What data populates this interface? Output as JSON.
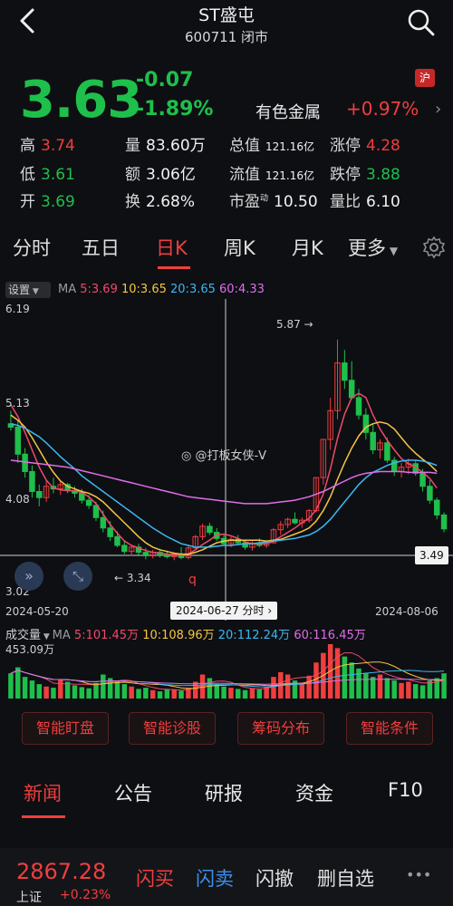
{
  "header": {
    "title": "ST盛屯",
    "subtitle": "600711 闭市"
  },
  "quote": {
    "price": "3.63",
    "change": "-0.07",
    "change_pct": "-1.89%",
    "market_tag": "沪",
    "sector_name": "有色金属",
    "sector_change": "+0.97%",
    "stats": [
      {
        "label": "高",
        "value": "3.74",
        "color": "red"
      },
      {
        "label": "量",
        "value": "83.60万",
        "color": "white"
      },
      {
        "label": "总值",
        "value": "121.16亿",
        "color": "white",
        "small": true
      },
      {
        "label": "涨停",
        "value": "4.28",
        "color": "red"
      },
      {
        "label": "低",
        "value": "3.61",
        "color": "green"
      },
      {
        "label": "额",
        "value": "3.06亿",
        "color": "white"
      },
      {
        "label": "流值",
        "value": "121.16亿",
        "color": "white",
        "small": true
      },
      {
        "label": "跌停",
        "value": "3.88",
        "color": "green"
      },
      {
        "label": "开",
        "value": "3.69",
        "color": "green"
      },
      {
        "label": "换",
        "value": "2.68%",
        "color": "white"
      },
      {
        "label": "市盈",
        "sup": "动",
        "value": "10.50",
        "color": "white"
      },
      {
        "label": "量比",
        "value": "6.10",
        "color": "white"
      }
    ]
  },
  "chart_tabs": [
    "分时",
    "五日",
    "日K",
    "周K",
    "月K",
    "更多"
  ],
  "active_chart_tab": "日K",
  "ma_legend": {
    "settings": "设置",
    "prefix": "MA",
    "items": [
      {
        "text": "5:3.69",
        "color": "#f04a6a"
      },
      {
        "text": "10:3.65",
        "color": "#f5c542"
      },
      {
        "text": "20:3.65",
        "color": "#3db8f0"
      },
      {
        "text": "60:4.33",
        "color": "#e06ee8"
      }
    ]
  },
  "chart_labels": {
    "y_top": "6.19",
    "y_upper": "5.13",
    "y_mid": "4.08",
    "y_bottom": "3.02",
    "high_mark": "5.87",
    "low_mark": "3.34",
    "cursor_price": "3.49",
    "cursor_date": "2024-06-27 分时",
    "date_start": "2024-05-20",
    "date_end": "2024-08-06",
    "watermark": "@打板女侠-V",
    "q_mark": "q"
  },
  "volume": {
    "title": "成交量",
    "prefix": "MA",
    "items": [
      {
        "text": "5:101.45万",
        "color": "#f04a6a"
      },
      {
        "text": "10:108.96万",
        "color": "#f5c542"
      },
      {
        "text": "20:112.24万",
        "color": "#3db8f0"
      },
      {
        "text": "60:116.45万",
        "color": "#e06ee8"
      }
    ],
    "max_label": "453.09万"
  },
  "tool_buttons": [
    "智能盯盘",
    "智能诊股",
    "筹码分布",
    "智能条件"
  ],
  "bottom_tabs": [
    "新闻",
    "公告",
    "研报",
    "资金",
    "F10"
  ],
  "active_bottom_tab": "新闻",
  "footer": {
    "index_value": "2867.28",
    "index_name": "上证",
    "index_change": "+0.23%",
    "buy": "闪买",
    "sell": "闪卖",
    "cancel": "闪撤",
    "remove": "删自选",
    "more": "•••"
  },
  "chart_data": {
    "type": "candlestick",
    "ylim": [
      3.02,
      6.19
    ],
    "candles": [
      [
        4.9,
        5.05,
        4.82,
        4.86
      ],
      [
        4.86,
        4.95,
        4.45,
        4.55
      ],
      [
        4.55,
        4.62,
        4.28,
        4.35
      ],
      [
        4.35,
        4.42,
        4.05,
        4.12
      ],
      [
        4.12,
        4.2,
        3.95,
        4.05
      ],
      [
        4.05,
        4.25,
        4.0,
        4.18
      ],
      [
        4.18,
        4.28,
        4.1,
        4.15
      ],
      [
        4.15,
        4.24,
        4.08,
        4.2
      ],
      [
        4.2,
        4.22,
        4.1,
        4.13
      ],
      [
        4.13,
        4.18,
        4.05,
        4.1
      ],
      [
        4.1,
        4.15,
        3.98,
        4.02
      ],
      [
        4.02,
        4.08,
        3.92,
        3.96
      ],
      [
        3.96,
        4.0,
        3.78,
        3.82
      ],
      [
        3.82,
        3.9,
        3.65,
        3.7
      ],
      [
        3.7,
        3.78,
        3.55,
        3.6
      ],
      [
        3.6,
        3.66,
        3.48,
        3.5
      ],
      [
        3.5,
        3.56,
        3.4,
        3.43
      ],
      [
        3.43,
        3.5,
        3.38,
        3.48
      ],
      [
        3.48,
        3.52,
        3.39,
        3.42
      ],
      [
        3.42,
        3.47,
        3.34,
        3.38
      ],
      [
        3.38,
        3.45,
        3.35,
        3.42
      ],
      [
        3.42,
        3.46,
        3.36,
        3.39
      ],
      [
        3.39,
        3.44,
        3.35,
        3.37
      ],
      [
        3.37,
        3.42,
        3.33,
        3.4
      ],
      [
        3.4,
        3.48,
        3.34,
        3.36
      ],
      [
        3.36,
        3.5,
        3.34,
        3.47
      ],
      [
        3.47,
        3.62,
        3.45,
        3.6
      ],
      [
        3.6,
        3.75,
        3.56,
        3.72
      ],
      [
        3.72,
        3.76,
        3.62,
        3.65
      ],
      [
        3.65,
        3.7,
        3.55,
        3.58
      ],
      [
        3.58,
        3.62,
        3.5,
        3.52
      ],
      [
        3.52,
        3.6,
        3.48,
        3.57
      ],
      [
        3.57,
        3.62,
        3.5,
        3.53
      ],
      [
        3.53,
        3.56,
        3.45,
        3.48
      ],
      [
        3.48,
        3.55,
        3.44,
        3.52
      ],
      [
        3.52,
        3.58,
        3.48,
        3.5
      ],
      [
        3.5,
        3.56,
        3.47,
        3.53
      ],
      [
        3.53,
        3.7,
        3.52,
        3.68
      ],
      [
        3.68,
        3.78,
        3.62,
        3.74
      ],
      [
        3.74,
        3.82,
        3.7,
        3.8
      ],
      [
        3.8,
        3.88,
        3.74,
        3.76
      ],
      [
        3.76,
        3.82,
        3.7,
        3.79
      ],
      [
        3.79,
        3.92,
        3.76,
        3.9
      ],
      [
        3.9,
        4.28,
        3.88,
        4.28
      ],
      [
        4.28,
        4.72,
        4.2,
        4.72
      ],
      [
        4.72,
        5.2,
        4.6,
        5.05
      ],
      [
        5.05,
        5.87,
        4.95,
        5.6
      ],
      [
        5.6,
        5.75,
        5.3,
        5.4
      ],
      [
        5.4,
        5.62,
        5.18,
        5.2
      ],
      [
        5.2,
        5.3,
        4.95,
        5.0
      ],
      [
        5.0,
        5.08,
        4.72,
        4.8
      ],
      [
        4.8,
        4.9,
        4.55,
        4.6
      ],
      [
        4.6,
        4.72,
        4.5,
        4.68
      ],
      [
        4.68,
        4.74,
        4.45,
        4.48
      ],
      [
        4.48,
        4.52,
        4.3,
        4.35
      ],
      [
        4.35,
        4.45,
        4.28,
        4.4
      ],
      [
        4.4,
        4.5,
        4.32,
        4.44
      ],
      [
        4.44,
        4.48,
        4.3,
        4.33
      ],
      [
        4.33,
        4.38,
        4.12,
        4.18
      ],
      [
        4.18,
        4.25,
        3.98,
        4.02
      ],
      [
        4.02,
        4.05,
        3.8,
        3.85
      ],
      [
        3.85,
        3.88,
        3.65,
        3.69
      ]
    ],
    "ma5": [
      5.12,
      4.98,
      4.8,
      4.6,
      4.4,
      4.25,
      4.16,
      4.14,
      4.13,
      4.13,
      4.11,
      4.06,
      3.98,
      3.86,
      3.74,
      3.64,
      3.55,
      3.5,
      3.47,
      3.44,
      3.42,
      3.41,
      3.4,
      3.39,
      3.39,
      3.4,
      3.45,
      3.51,
      3.56,
      3.62,
      3.63,
      3.61,
      3.58,
      3.54,
      3.52,
      3.52,
      3.52,
      3.55,
      3.6,
      3.65,
      3.7,
      3.76,
      3.81,
      3.91,
      4.09,
      4.38,
      4.73,
      5.01,
      5.2,
      5.25,
      5.2,
      5.0,
      4.84,
      4.71,
      4.6,
      4.5,
      4.44,
      4.4,
      4.34,
      4.27,
      4.16,
      3.69
    ],
    "ma10": [
      5.0,
      4.94,
      4.86,
      4.74,
      4.6,
      4.46,
      4.34,
      4.24,
      4.18,
      4.15,
      4.12,
      4.1,
      4.06,
      4.0,
      3.92,
      3.84,
      3.76,
      3.68,
      3.6,
      3.53,
      3.48,
      3.45,
      3.43,
      3.41,
      3.4,
      3.4,
      3.42,
      3.45,
      3.49,
      3.53,
      3.55,
      3.56,
      3.56,
      3.56,
      3.56,
      3.56,
      3.55,
      3.56,
      3.57,
      3.6,
      3.63,
      3.66,
      3.7,
      3.78,
      3.9,
      4.06,
      4.26,
      4.45,
      4.62,
      4.76,
      4.86,
      4.9,
      4.92,
      4.9,
      4.84,
      4.74,
      4.64,
      4.56,
      4.49,
      4.43,
      4.35,
      3.65
    ],
    "ma20": [
      4.9,
      4.88,
      4.85,
      4.8,
      4.75,
      4.68,
      4.6,
      4.52,
      4.45,
      4.38,
      4.3,
      4.24,
      4.18,
      4.12,
      4.06,
      4.0,
      3.94,
      3.88,
      3.82,
      3.76,
      3.7,
      3.65,
      3.6,
      3.56,
      3.52,
      3.5,
      3.48,
      3.48,
      3.48,
      3.49,
      3.5,
      3.5,
      3.51,
      3.52,
      3.52,
      3.53,
      3.54,
      3.55,
      3.56,
      3.57,
      3.58,
      3.6,
      3.62,
      3.66,
      3.72,
      3.8,
      3.9,
      4.0,
      4.1,
      4.2,
      4.28,
      4.34,
      4.38,
      4.42,
      4.45,
      4.47,
      4.48,
      4.48,
      4.47,
      4.45,
      4.42,
      3.65
    ],
    "ma60": [
      4.48,
      4.47,
      4.46,
      4.45,
      4.44,
      4.43,
      4.42,
      4.41,
      4.4,
      4.38,
      4.36,
      4.34,
      4.32,
      4.3,
      4.28,
      4.26,
      4.24,
      4.22,
      4.2,
      4.18,
      4.16,
      4.14,
      4.12,
      4.1,
      4.08,
      4.06,
      4.05,
      4.04,
      4.03,
      4.02,
      4.01,
      4.0,
      3.99,
      3.98,
      3.98,
      3.98,
      3.98,
      3.99,
      4.0,
      4.01,
      4.02,
      4.04,
      4.06,
      4.09,
      4.12,
      4.16,
      4.2,
      4.24,
      4.28,
      4.31,
      4.33,
      4.34,
      4.35,
      4.35,
      4.35,
      4.35,
      4.34,
      4.34,
      4.34,
      4.34,
      4.33,
      4.33
    ],
    "volumes": [
      210,
      260,
      180,
      150,
      120,
      100,
      90,
      160,
      140,
      110,
      95,
      85,
      130,
      200,
      170,
      150,
      120,
      100,
      80,
      90,
      70,
      60,
      80,
      75,
      65,
      90,
      140,
      200,
      170,
      120,
      100,
      90,
      80,
      70,
      85,
      75,
      95,
      180,
      220,
      200,
      150,
      130,
      190,
      300,
      380,
      453,
      420,
      350,
      300,
      250,
      210,
      180,
      200,
      170,
      150,
      130,
      140,
      120,
      110,
      150,
      170,
      210
    ]
  }
}
